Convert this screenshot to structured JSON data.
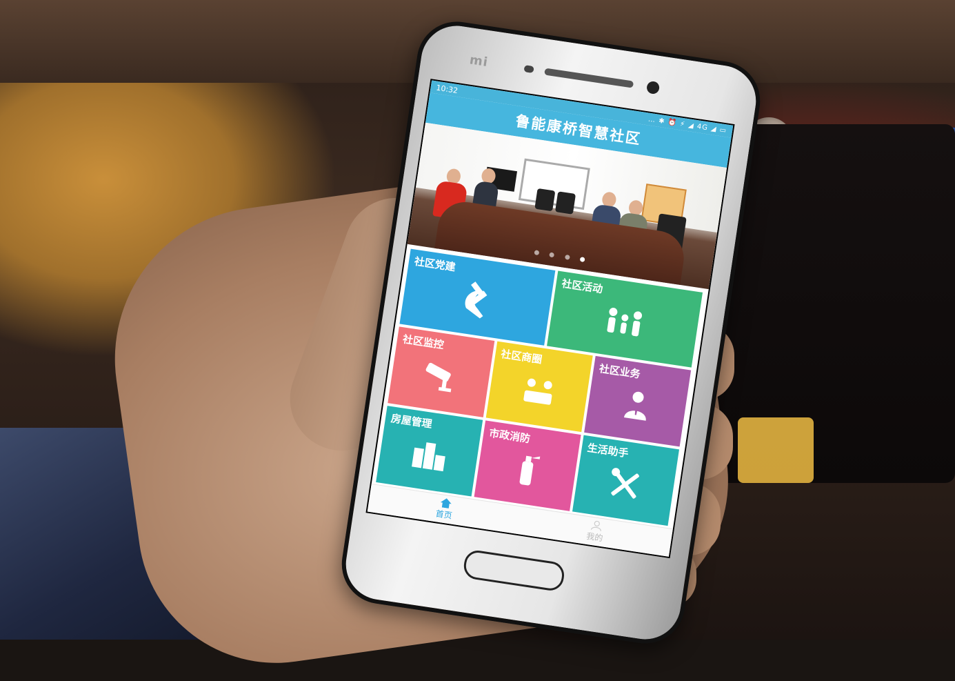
{
  "status_bar": {
    "time": "10:32",
    "icons": "… ✱ ⏰ ⚡ ◢ 4G ◢ ▭"
  },
  "phone": {
    "brand": "mi"
  },
  "app": {
    "title": "鲁能康桥智慧社区"
  },
  "banner": {
    "dots_count": 4,
    "active_dot": 4
  },
  "tiles": [
    {
      "label": "社区党建",
      "icon": "hammer-sickle-icon",
      "color": "#2ea6df"
    },
    {
      "label": "社区活动",
      "icon": "people-group-icon",
      "color": "#3cb87a"
    },
    {
      "label": "社区监控",
      "icon": "cctv-camera-icon",
      "color": "#f2737a"
    },
    {
      "label": "社区商圈",
      "icon": "shopping-people-icon",
      "color": "#f3d42a"
    },
    {
      "label": "社区业务",
      "icon": "business-person-icon",
      "color": "#a65aa7"
    },
    {
      "label": "房屋管理",
      "icon": "buildings-icon",
      "color": "#27b2b2"
    },
    {
      "label": "市政消防",
      "icon": "fire-extinguisher-icon",
      "color": "#e2579d"
    },
    {
      "label": "生活助手",
      "icon": "tools-icon",
      "color": "#27b2b2"
    }
  ],
  "tabbar": {
    "home_label": "首页",
    "profile_label": "我的"
  }
}
